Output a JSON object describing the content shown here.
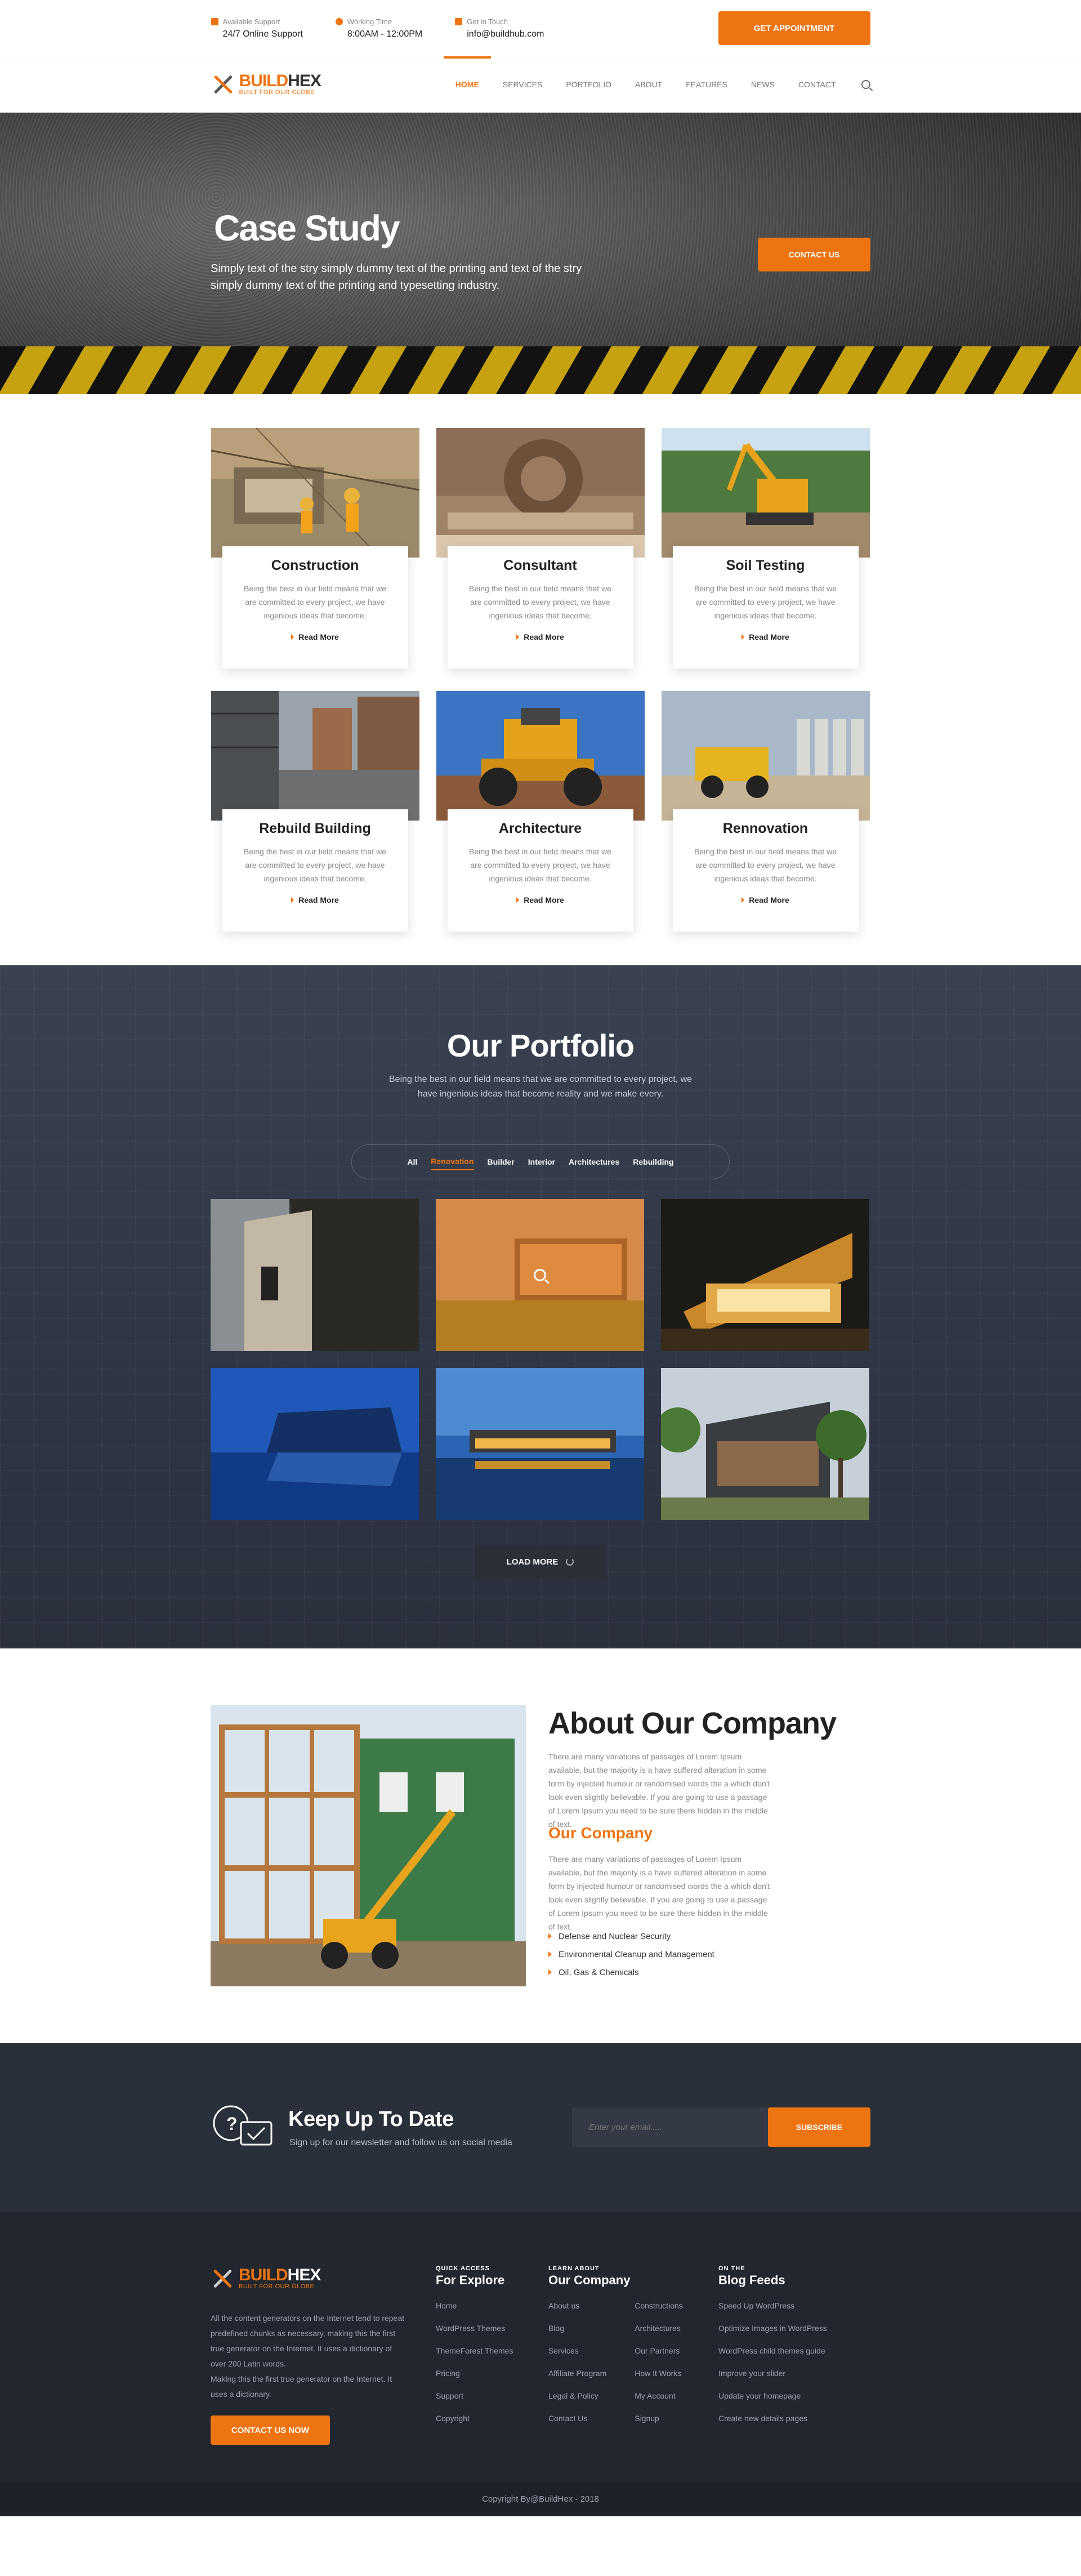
{
  "topbar": {
    "support_label": "Available Support",
    "support_value": "24/7 Online Support",
    "time_label": "Working Time",
    "time_value": "8:00AM - 12:00PM",
    "contact_label": "Get in Touch",
    "contact_value": "info@buildhub.com",
    "appointment_button": "GET APPOINTMENT"
  },
  "brand": {
    "name_part1": "BUILD",
    "name_part2": "HEX",
    "tagline": "BUILT FOR OUR GLOBE",
    "accent_color": "#ee7411"
  },
  "nav": {
    "items": [
      "HOME",
      "SERVICES",
      "PORTFOLIO",
      "ABOUT",
      "FEATURES",
      "NEWS",
      "CONTACT"
    ],
    "active": "HOME"
  },
  "hero": {
    "title": "Case Study",
    "subtitle": "Simply text of the stry simply dummy text of the printing and text of the stry simply dummy text of the printing and typesetting industry.",
    "button": "CONTACT US"
  },
  "services": [
    {
      "title": "Construction",
      "text": "Being the best in our field means that we are committed to every project, we have ingenious ideas that become.",
      "link": "Read More"
    },
    {
      "title": "Consultant",
      "text": "Being the best in our field means that we are committed to every project, we have ingenious ideas that become.",
      "link": "Read More"
    },
    {
      "title": "Soil Testing",
      "text": "Being the best in our field means that we are committed to every project, we have ingenious ideas that become.",
      "link": "Read More"
    },
    {
      "title": "Rebuild Building",
      "text": "Being the best in our field means that we are committed to every project, we have ingenious ideas that become.",
      "link": "Read More"
    },
    {
      "title": "Architecture",
      "text": "Being the best in our field means that we are committed to every project, we have ingenious ideas that become.",
      "link": "Read More"
    },
    {
      "title": "Rennovation",
      "text": "Being the best in our field means that we are committed to every project, we have ingenious ideas that become.",
      "link": "Read More"
    }
  ],
  "portfolio": {
    "title": "Our Portfolio",
    "subtitle": "Being the best in our field means that we are committed to every project, we have ingenious ideas that become reality and we make every.",
    "filters": [
      "All",
      "Renovation",
      "Builder",
      "Interior",
      "Architectures",
      "Rebuilding"
    ],
    "active_filter": "Renovation",
    "load_more": "LOAD MORE"
  },
  "about": {
    "title": "About Our Company",
    "para1": "There are many variations of passages of Lorem Ipsum available, but the majority is a have suffered alteration in some form by injected humour or randomised words the a which don't look even slightly believable. If you are going to use a passage of Lorem Ipsum you need to be sure there hidden in the middle of text.",
    "subtitle": "Our Company",
    "para2": "There are many variations of passages of Lorem Ipsum available, but the majority is a have suffered alteration in some form by injected humour or randomised words the a which don't look even slightly believable. If you are going to use a passage of Lorem Ipsum you need to be sure there hidden in the middle of text.",
    "list": [
      "Defense and Nuclear Security",
      "Environmental Cleanup and Management",
      "Oil, Gas & Chemicals"
    ]
  },
  "newsletter": {
    "title": "Keep Up To Date",
    "subtitle": "Sign up for our newsletter and follow us on social media",
    "placeholder": "Enter your email.....",
    "button": "SUBSCRIBE"
  },
  "footer": {
    "about": "All the content generators on the Internet tend to repeat predefined chunks as necessary, making this the first true generator on the Internet. It uses a dictionary of over 200 Latin words.",
    "about2": "Making this the first true generator on the Internet. It uses a dictionary.",
    "cta": "CONTACT US NOW",
    "explore_small": "QUICK ACCESS",
    "explore_title": "For Explore",
    "explore_links": [
      "Home",
      "WordPress Themes",
      "ThemeForest Themes",
      "Pricing",
      "Support",
      "Copyright"
    ],
    "company_small": "LEARN ABOUT",
    "company_title": "Our Company",
    "company_links_a": [
      "About us",
      "Blog",
      "Services",
      "Affiliate Program",
      "Legal & Policy",
      "Contact Us"
    ],
    "company_links_b": [
      "Constructions",
      "Architectures",
      "Our Partners",
      "How It Works",
      "My Account",
      "Signup"
    ],
    "blog_small": "ON THE",
    "blog_title": "Blog Feeds",
    "blog_links": [
      "Speed Up WordPress",
      "Optimize Images in WordPress",
      "WordPress child themes guide",
      "Improve your slider",
      "Update your homepage",
      "Create new details pages"
    ],
    "copyright": "Copyright By@BuildHex - 2018"
  }
}
